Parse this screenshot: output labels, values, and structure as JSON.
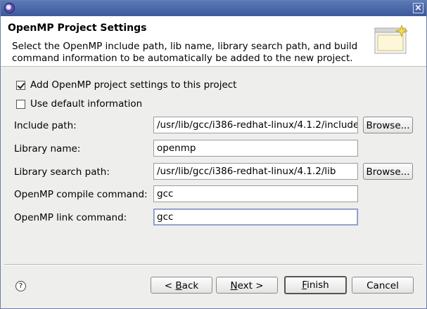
{
  "titlebar": {
    "icon": "eclipse-icon",
    "close": "close-icon"
  },
  "header": {
    "title": "OpenMP Project Settings",
    "description": "Select the OpenMP include path, lib name, library search path, and build command information to be automatically be added to the new project.",
    "banner_icon": "wizard-banner-icon"
  },
  "options": {
    "add_settings": {
      "label": "Add OpenMP project settings to this project",
      "checked": true
    },
    "use_default": {
      "label": "Use default information",
      "checked": false
    }
  },
  "fields": {
    "include_path": {
      "label": "Include path:",
      "value": "/usr/lib/gcc/i386-redhat-linux/4.1.2/include",
      "browse": "Browse..."
    },
    "library_name": {
      "label": "Library name:",
      "value": "openmp"
    },
    "library_search_path": {
      "label": "Library search path:",
      "value": "/usr/lib/gcc/i386-redhat-linux/4.1.2/lib",
      "browse": "Browse..."
    },
    "compile_command": {
      "label": "OpenMP compile command:",
      "value": "gcc"
    },
    "link_command": {
      "label": "OpenMP link command:",
      "value": "gcc"
    }
  },
  "buttons": {
    "help": "?",
    "back": {
      "prefix": "< ",
      "mnemonic": "B",
      "rest": "ack"
    },
    "next": {
      "mnemonic": "N",
      "rest": "ext >"
    },
    "finish": {
      "mnemonic": "F",
      "rest": "inish"
    },
    "cancel": "Cancel"
  }
}
